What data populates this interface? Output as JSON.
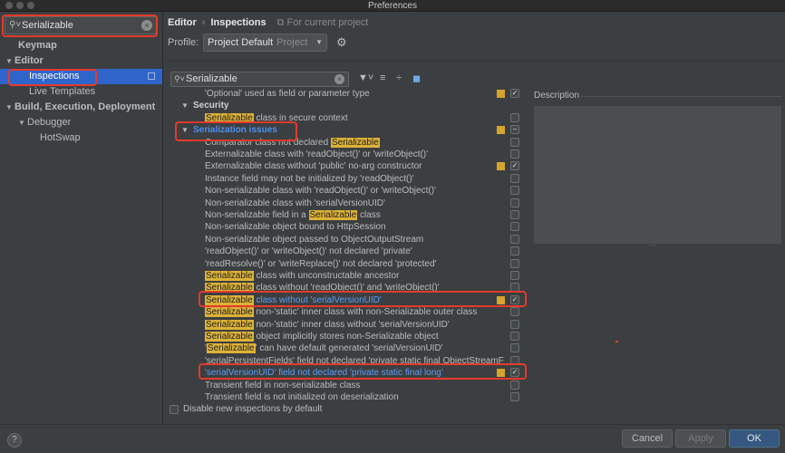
{
  "window": {
    "title": "Preferences"
  },
  "sidebar": {
    "search": {
      "value": "Serializable",
      "icon": "search-icon"
    },
    "items": [
      {
        "label": "Keymap"
      },
      {
        "label": "Editor"
      },
      {
        "label": "Inspections"
      },
      {
        "label": "Live Templates"
      },
      {
        "label": "Build, Execution, Deployment"
      },
      {
        "label": "Debugger"
      },
      {
        "label": "HotSwap"
      }
    ]
  },
  "breadcrumb": {
    "part1": "Editor",
    "part2": "Inspections",
    "note": "For current project"
  },
  "profile": {
    "label": "Profile:",
    "value": "Project Default",
    "sub": "Project"
  },
  "inspections_search": {
    "value": "Serializable"
  },
  "highlight_word": "Serializable",
  "inspections": [
    {
      "pre": "'Optional' used as field or parameter type",
      "post": "",
      "sev": true,
      "checked": true
    },
    {
      "label": "Security",
      "category": true
    },
    {
      "pre": "",
      "post": " class in secure context",
      "sev": false,
      "checked": false
    },
    {
      "label": "Serialization issues",
      "category": true
    },
    {
      "pre": "Comparator class not declared ",
      "post": "",
      "sev": false,
      "checked": false
    },
    {
      "pre": "Externalizable class with 'readObject()' or 'writeObject()'",
      "post": "",
      "sev": false,
      "checked": false
    },
    {
      "pre": "Externalizable class without 'public' no-arg constructor",
      "post": "",
      "sev": true,
      "checked": true
    },
    {
      "pre": "Instance field may not be initialized by 'readObject()'",
      "post": "",
      "sev": false,
      "checked": false
    },
    {
      "pre": "Non-serializable class with 'readObject()' or 'writeObject()'",
      "post": "",
      "sev": false,
      "checked": false
    },
    {
      "pre": "Non-serializable class with 'serialVersionUID'",
      "post": "",
      "sev": false,
      "checked": false
    },
    {
      "pre": "Non-serializable field in a ",
      "post": " class",
      "sev": false,
      "checked": false
    },
    {
      "pre": "Non-serializable object bound to HttpSession",
      "post": "",
      "sev": false,
      "checked": false
    },
    {
      "pre": "Non-serializable object passed to ObjectOutputStream",
      "post": "",
      "sev": false,
      "checked": false
    },
    {
      "pre": "'readObject()' or 'writeObject()' not declared 'private'",
      "post": "",
      "sev": false,
      "checked": false
    },
    {
      "pre": "'readResolve()' or 'writeReplace()' not declared 'protected'",
      "post": "",
      "sev": false,
      "checked": false
    },
    {
      "pre": "",
      "post": " class with unconstructable ancestor",
      "sev": false,
      "checked": false
    },
    {
      "pre": "",
      "post": " class without 'readObject()' and 'writeObject()'",
      "sev": false,
      "checked": false
    },
    {
      "pre": "",
      "post": " class without 'serialVersionUID'",
      "sev": true,
      "checked": true
    },
    {
      "pre": "",
      "post": " non-'static' inner class with non-Serializable outer class",
      "sev": false,
      "checked": false
    },
    {
      "pre": "",
      "post": " non-'static' inner class without 'serialVersionUID'",
      "sev": false,
      "checked": false
    },
    {
      "pre": "",
      "post": " object implicitly stores non-Serializable object",
      "sev": false,
      "checked": false
    },
    {
      "pre": "'",
      "post": "' can have default generated 'serialVersionUID'",
      "sev": false,
      "checked": false
    },
    {
      "pre": "'serialPersistentFields' field not declared 'private static final ObjectStreamF",
      "post": "",
      "sev": false,
      "checked": false
    },
    {
      "pre": "'serialVersionUID' field not declared 'private static final long'",
      "post": "",
      "sev": true,
      "checked": true
    },
    {
      "pre": "Transient field in non-serializable class",
      "post": "",
      "sev": false,
      "checked": false
    },
    {
      "pre": "Transient field is not initialized on deserialization",
      "post": "",
      "sev": false,
      "checked": false
    }
  ],
  "disable_new": {
    "label": "Disable new inspections by default"
  },
  "description": {
    "label": "Description"
  },
  "buttons": {
    "help": "?",
    "cancel": "Cancel",
    "apply": "Apply",
    "ok": "OK"
  },
  "colors": {
    "selection": "#2f65ca",
    "highlight": "#dcb236",
    "link_blue": "#589df6",
    "annotation_red": "#e53a2a"
  }
}
